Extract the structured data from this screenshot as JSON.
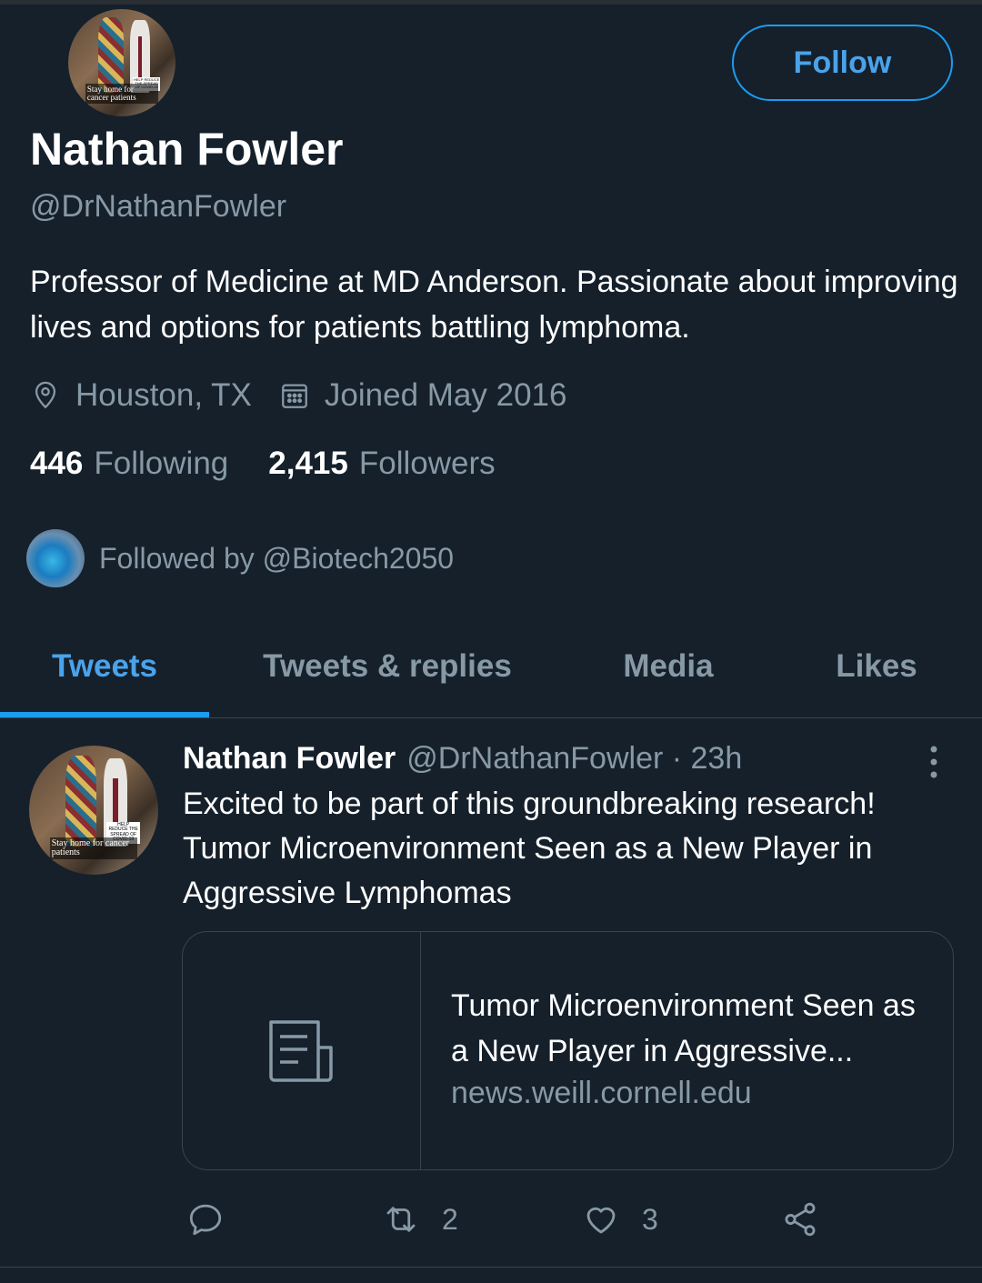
{
  "profile": {
    "avatar_caption": "Stay home for cancer patients",
    "avatar_badge": "HELP REDUCE THE SPREAD OF COVID-19",
    "follow_label": "Follow",
    "name": "Nathan Fowler",
    "handle": "@DrNathanFowler",
    "bio": "Professor of Medicine at MD Anderson. Passionate about improving lives and options for patients battling lymphoma.",
    "location_icon": "location-pin-icon",
    "location": "Houston, TX",
    "joined_icon": "calendar-icon",
    "joined": "Joined May 2016",
    "following_count": "446",
    "following_label": "Following",
    "followers_count": "2,415",
    "followers_label": "Followers",
    "followed_by": "Followed by @Biotech2050"
  },
  "tabs": [
    {
      "label": "Tweets",
      "active": true
    },
    {
      "label": "Tweets & replies",
      "active": false
    },
    {
      "label": "Media",
      "active": false
    },
    {
      "label": "Likes",
      "active": false
    }
  ],
  "tweet": {
    "author": "Nathan Fowler",
    "meta": "@DrNathanFowler · 23h",
    "text": "Excited to be part of this groundbreaking research! Tumor Microenvironment Seen as a New Player in Aggressive Lymphomas",
    "card": {
      "icon": "article-icon",
      "title": "Tumor Microenvironment Seen as a New Player in Aggressive...",
      "domain": "news.weill.cornell.edu"
    },
    "actions": {
      "reply_icon": "reply-icon",
      "retweet_icon": "retweet-icon",
      "retweet_count": "2",
      "like_icon": "heart-icon",
      "like_count": "3",
      "share_icon": "share-icon"
    }
  },
  "colors": {
    "background": "#15202b",
    "accent": "#1d9bf0",
    "muted": "#8899a6",
    "divider": "#38444d"
  }
}
